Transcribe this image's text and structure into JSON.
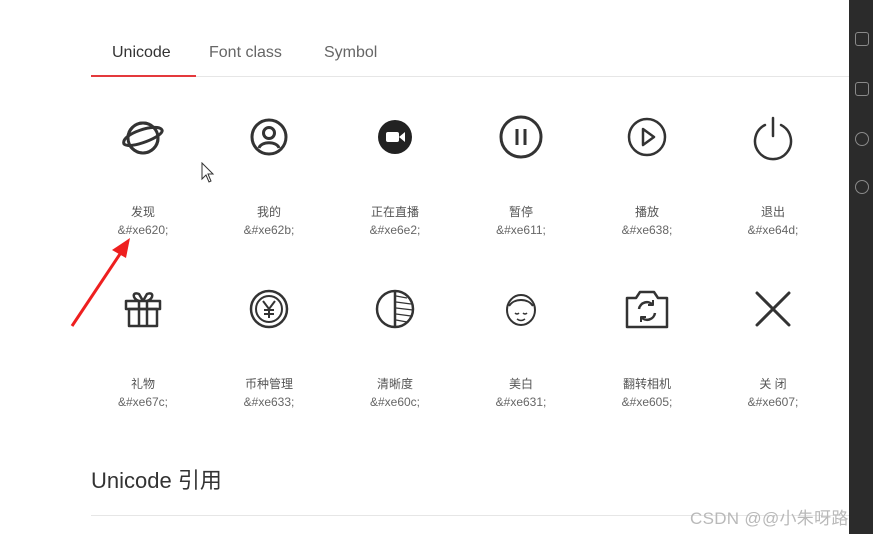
{
  "tabs": {
    "items": [
      "Unicode",
      "Font class",
      "Symbol"
    ],
    "active": "Unicode",
    "accent_color": "#e4393c"
  },
  "icons": [
    {
      "name": "发现",
      "code": "&#xe620;",
      "icon": "planet-icon"
    },
    {
      "name": "我的",
      "code": "&#xe62b;",
      "icon": "user-circle-icon"
    },
    {
      "name": "正在直播",
      "code": "&#xe6e2;",
      "icon": "live-camera-icon"
    },
    {
      "name": "暂停",
      "code": "&#xe611;",
      "icon": "pause-icon"
    },
    {
      "name": "播放",
      "code": "&#xe638;",
      "icon": "play-icon"
    },
    {
      "name": "退出",
      "code": "&#xe64d;",
      "icon": "power-icon"
    },
    {
      "name": "礼物",
      "code": "&#xe67c;",
      "icon": "gift-icon"
    },
    {
      "name": "币种管理",
      "code": "&#xe633;",
      "icon": "currency-yen-icon"
    },
    {
      "name": "清晰度",
      "code": "&#xe60c;",
      "icon": "half-circle-icon"
    },
    {
      "name": "美白",
      "code": "&#xe631;",
      "icon": "face-icon"
    },
    {
      "name": "翻转相机",
      "code": "&#xe605;",
      "icon": "flip-camera-icon"
    },
    {
      "name": "关 闭",
      "code": "&#xe607;",
      "icon": "close-icon"
    }
  ],
  "section": {
    "title": "Unicode 引用"
  },
  "watermark": "CSDN @@小朱呀路"
}
